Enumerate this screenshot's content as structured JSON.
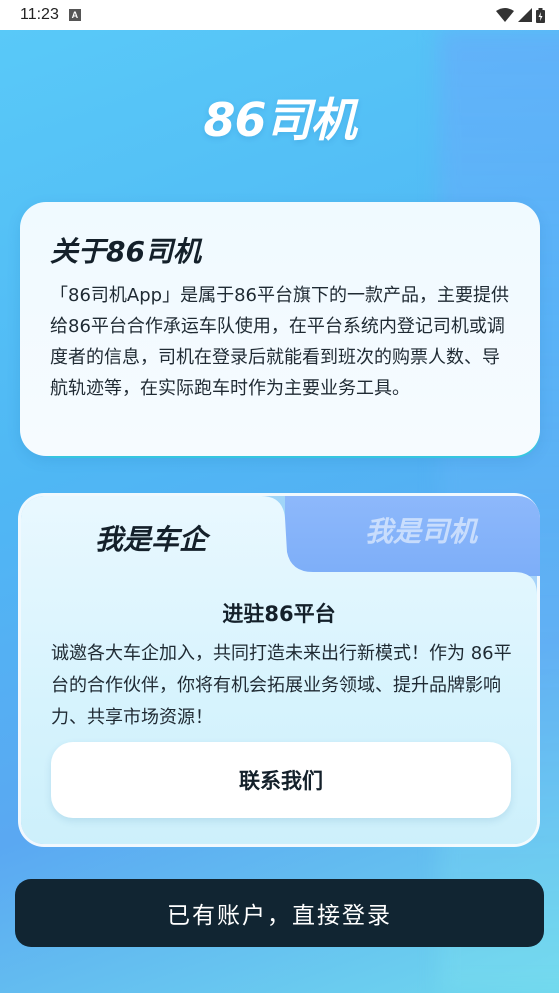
{
  "status_bar": {
    "time": "11:23",
    "notification_icon": "a-notification-icon",
    "wifi_icon": "wifi-icon",
    "signal_icon": "signal-icon",
    "battery_icon": "battery-icon"
  },
  "app": {
    "logo": "86司机"
  },
  "about": {
    "title": "关于86司机",
    "text": "「86司机App」是属于86平台旗下的一款产品，主要提供给86平台合作承运车队使用，在平台系统内登记司机或调度者的信息，司机在登录后就能看到班次的购票人数、导航轨迹等，在实际跑车时作为主要业务工具。"
  },
  "role_tabs": {
    "company_label": "我是车企",
    "driver_label": "我是司机"
  },
  "company_section": {
    "title": "进驻86平台",
    "text": "诚邀各大车企加入，共同打造未来出行新模式！作为 86平台的合作伙伴，你将有机会拓展业务领域、提升品牌影响力、共享市场资源！",
    "contact_label": "联系我们"
  },
  "login": {
    "label": "已有账户，直接登录"
  },
  "colors": {
    "accent_dark": "#112532",
    "background_blue": "#4fb7f4",
    "card_light": "#f0faff"
  }
}
